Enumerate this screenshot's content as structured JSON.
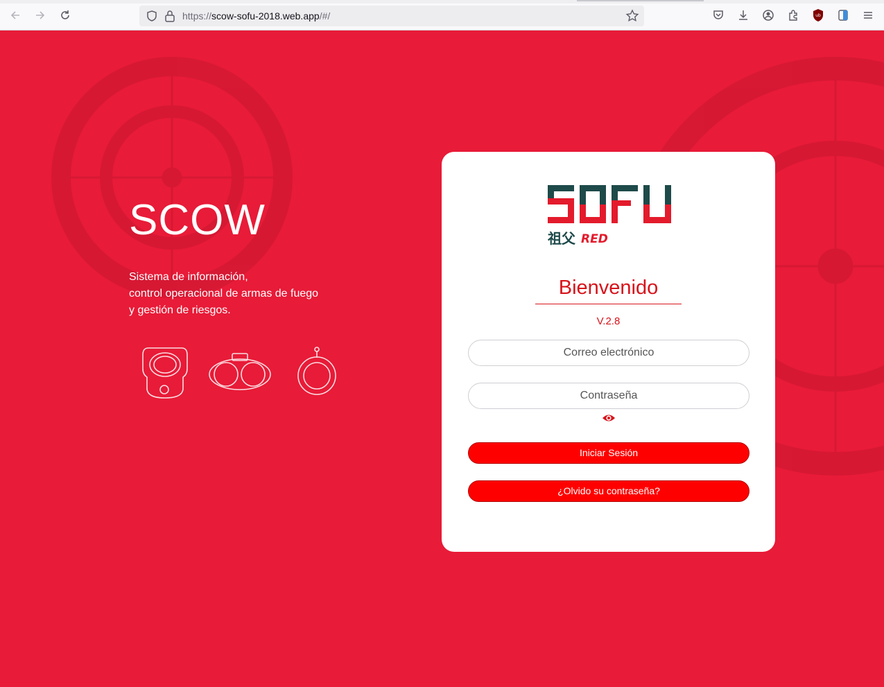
{
  "browser": {
    "url_prefix": "https://",
    "url_host": "scow-sofu-2018.web.app",
    "url_path": "/#/",
    "icons": [
      "back-icon",
      "forward-icon",
      "reload-icon",
      "shield-icon",
      "lock-icon",
      "bookmark-star-icon",
      "pocket-icon",
      "download-icon",
      "account-icon",
      "extensions-icon",
      "ublock-icon",
      "reader-icon",
      "menu-icon"
    ]
  },
  "hero": {
    "title": "SCOW",
    "desc_line1": "Sistema de información,",
    "desc_line2": "control operacional de armas de fuego",
    "desc_line3": "y gestión de riesgos."
  },
  "card": {
    "logo_text": "SOFU",
    "logo_sub_cjk": "祖父",
    "logo_sub": "RED",
    "welcome": "Bienvenido",
    "version": "V.2.8",
    "email_placeholder": "Correo electrónico",
    "password_placeholder": "Contraseña",
    "login_label": "Iniciar Sesión",
    "forgot_label": "¿Olvido su contraseña?"
  },
  "colors": {
    "background": "#e81b38",
    "accent": "#d7141b",
    "button": "#ff0000",
    "logo_dark": "#1e4a4a"
  }
}
